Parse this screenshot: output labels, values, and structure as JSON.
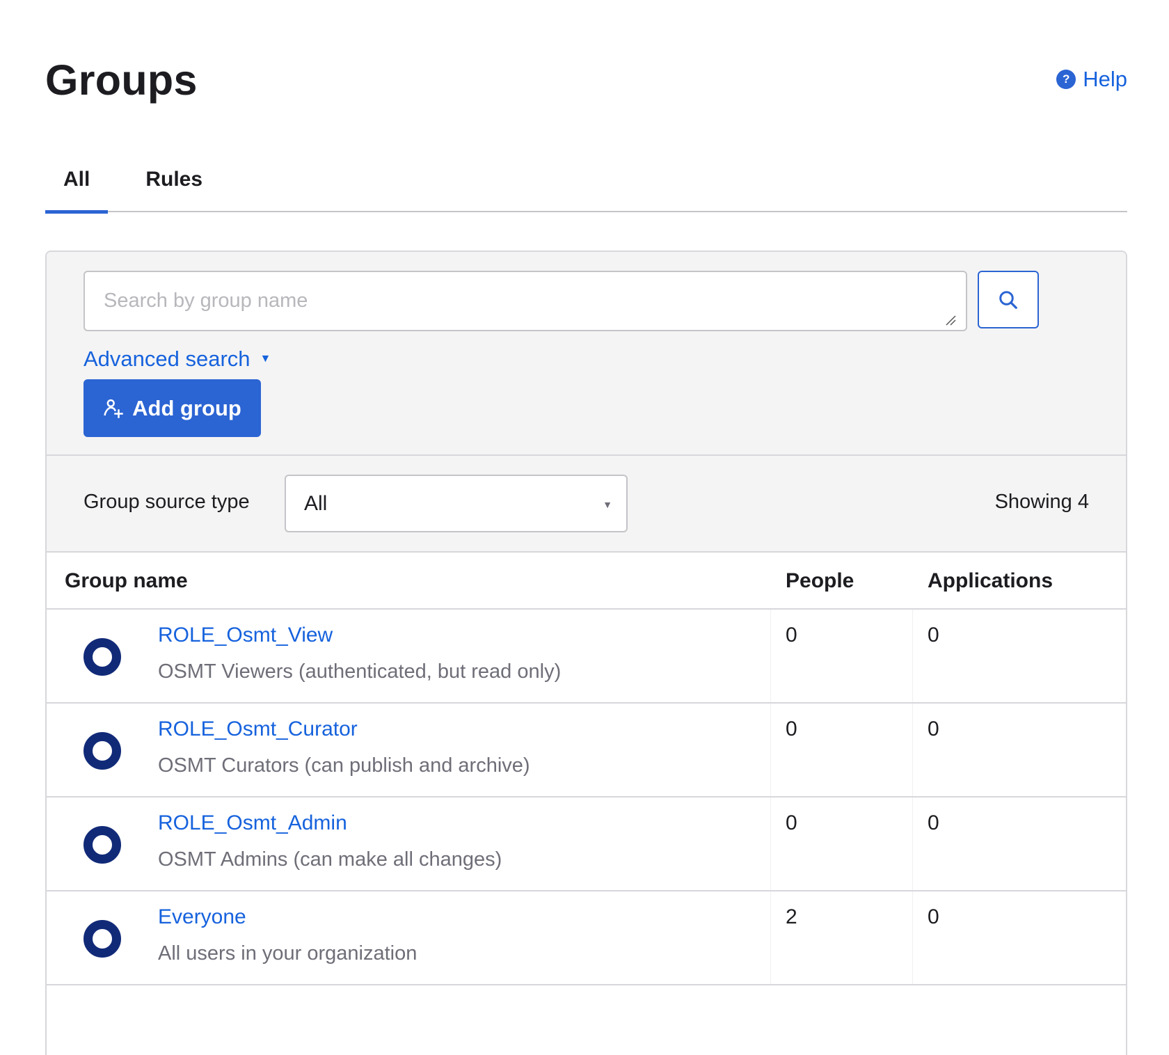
{
  "header": {
    "title": "Groups",
    "help_label": "Help",
    "help_icon": "?"
  },
  "tabs": [
    {
      "label": "All",
      "active": true
    },
    {
      "label": "Rules",
      "active": false
    }
  ],
  "search": {
    "placeholder": "Search by group name",
    "value": "",
    "advanced_label": "Advanced search",
    "advanced_caret": "▼"
  },
  "actions": {
    "add_group_label": "Add group"
  },
  "filter": {
    "label": "Group source type",
    "selected": "All",
    "caret": "▼",
    "showing_label": "Showing 4"
  },
  "table": {
    "columns": [
      "Group name",
      "People",
      "Applications"
    ],
    "rows": [
      {
        "name": "ROLE_Osmt_View",
        "description": "OSMT Viewers (authenticated, but read only)",
        "people": "0",
        "applications": "0"
      },
      {
        "name": "ROLE_Osmt_Curator",
        "description": "OSMT Curators (can publish and archive)",
        "people": "0",
        "applications": "0"
      },
      {
        "name": "ROLE_Osmt_Admin",
        "description": "OSMT Admins (can make all changes)",
        "people": "0",
        "applications": "0"
      },
      {
        "name": "Everyone",
        "description": "All users in your organization",
        "people": "2",
        "applications": "0"
      }
    ]
  },
  "colors": {
    "accent": "#2b64d3",
    "link": "#1662dd",
    "group_icon": "#112a78",
    "panel_bg": "#f4f4f4"
  }
}
